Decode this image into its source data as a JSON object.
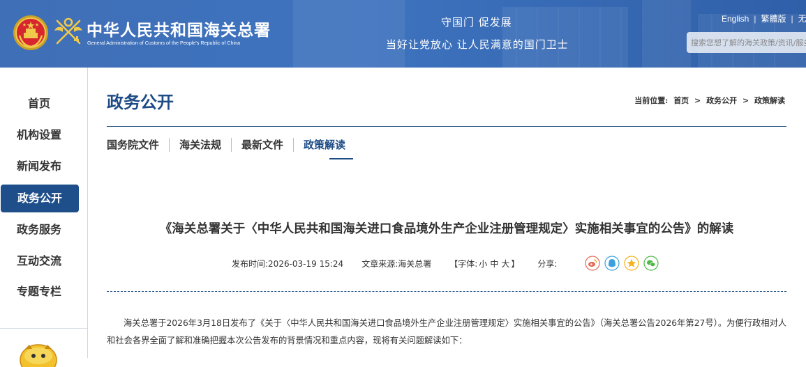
{
  "header": {
    "site_title": "中华人民共和国海关总署",
    "site_subtitle": "General Administration of Customs of the People's Republic of China",
    "slogan_line1": "守国门  促发展",
    "slogan_line2": "当好让党放心  让人民满意的国门卫士",
    "lang_english": "English",
    "lang_traditional": "繁體版",
    "lang_accessible": "无障",
    "search_placeholder": "搜索您想了解的海关政策/资讯/服务"
  },
  "sidebar": {
    "items": [
      {
        "label": "首页"
      },
      {
        "label": "机构设置"
      },
      {
        "label": "新闻发布"
      },
      {
        "label": "政务公开",
        "active": true
      },
      {
        "label": "政务服务"
      },
      {
        "label": "互动交流"
      },
      {
        "label": "专题专栏"
      }
    ]
  },
  "section": {
    "title": "政务公开",
    "breadcrumb_prefix": "当前位置:",
    "breadcrumb": [
      "首页",
      "政务公开",
      "政策解读"
    ],
    "breadcrumb_sep": ">"
  },
  "tabs": [
    {
      "label": "国务院文件"
    },
    {
      "label": "海关法规"
    },
    {
      "label": "最新文件"
    },
    {
      "label": "政策解读",
      "active": true
    }
  ],
  "article": {
    "title": "《海关总署关于〈中华人民共和国海关进口食品境外生产企业注册管理规定〉实施相关事宜的公告》的解读",
    "date_label": "发布时间:",
    "date": "2026-03-19 15:24",
    "source_label": "文章来源:",
    "source": "海关总署",
    "font_label_open": "【字体:",
    "font_small": "小",
    "font_medium": "中",
    "font_large": "大",
    "font_label_close": "】",
    "share_label": "分享:",
    "share_icons": [
      "weibo-icon",
      "qq-icon",
      "qzone-icon",
      "wechat-icon"
    ],
    "paragraph": "海关总署于2026年3月18日发布了《关于〈中华人民共和国海关进口食品境外生产企业注册管理规定〉实施相关事宜的公告》（海关总署公告2026年第27号）。为便行政相对人和社会各界全面了解和准确把握本次公告发布的背景情况和重点内容，现将有关问题解读如下："
  },
  "colors": {
    "header_blue": "#3e73bf",
    "accent_navy": "#1e4c86",
    "active_nav_bg": "#1f4f8a"
  }
}
